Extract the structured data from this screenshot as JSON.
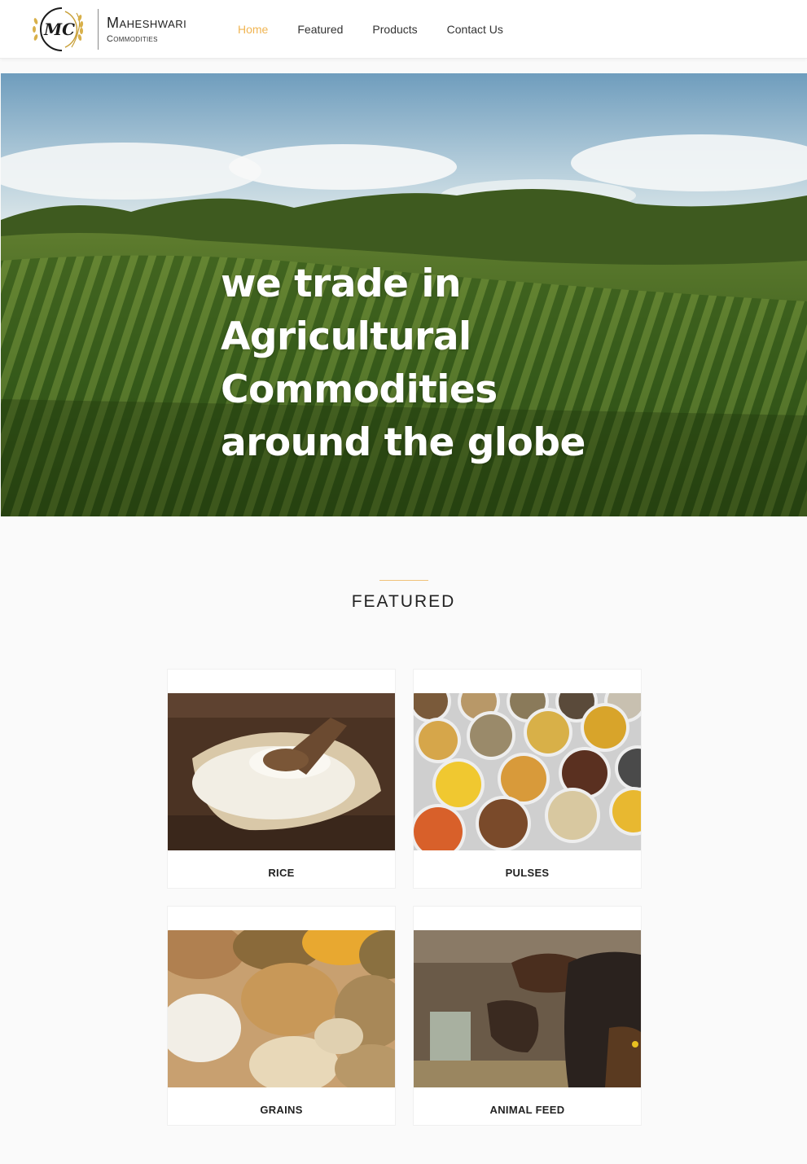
{
  "brand": {
    "name": "Maheshwari",
    "subtitle": "Commodities",
    "monogram": "MC",
    "accent_color": "#f0b553"
  },
  "nav": {
    "items": [
      {
        "label": "Home",
        "active": true
      },
      {
        "label": "Featured",
        "active": false
      },
      {
        "label": "Products",
        "active": false
      },
      {
        "label": "Contact Us",
        "active": false
      }
    ]
  },
  "hero": {
    "lines": [
      "we trade in",
      "Agricultural",
      "Commodities",
      "around the globe"
    ]
  },
  "featured": {
    "title": "FEATURED",
    "items": [
      {
        "label": "RICE",
        "image": "rice-photo"
      },
      {
        "label": "PULSES",
        "image": "pulses-photo"
      },
      {
        "label": "GRAINS",
        "image": "grains-photo"
      },
      {
        "label": "ANIMAL FEED",
        "image": "animal-feed-photo"
      }
    ]
  }
}
